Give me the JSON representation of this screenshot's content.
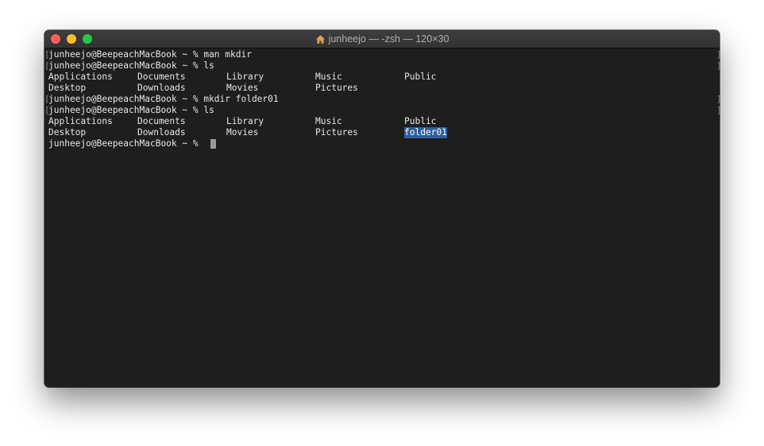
{
  "window": {
    "title": "junheejo — -zsh — 120×30",
    "traffic_lights": {
      "close_color": "#ff5f57",
      "minimize_color": "#febc2e",
      "zoom_color": "#28c840"
    },
    "title_icon": "home-icon"
  },
  "terminal": {
    "background": "#1e1e1e",
    "lines": [
      {
        "type": "prompt",
        "text": "junheejo@BeepeachMacBook ~ % man mkdir"
      },
      {
        "type": "prompt",
        "text": "junheejo@BeepeachMacBook ~ % ls"
      },
      {
        "type": "ls",
        "cols": [
          "Applications",
          "Documents",
          "Library",
          "Music",
          "Public"
        ]
      },
      {
        "type": "ls",
        "cols": [
          "Desktop",
          "Downloads",
          "Movies",
          "Pictures",
          ""
        ]
      },
      {
        "type": "prompt",
        "text": "junheejo@BeepeachMacBook ~ % mkdir folder01"
      },
      {
        "type": "prompt",
        "text": "junheejo@BeepeachMacBook ~ % ls"
      },
      {
        "type": "ls",
        "cols": [
          "Applications",
          "Documents",
          "Library",
          "Music",
          "Public"
        ]
      },
      {
        "type": "ls",
        "cols": [
          "Desktop",
          "Downloads",
          "Movies",
          "Pictures",
          "folder01"
        ],
        "highlight_col": 4
      },
      {
        "type": "current",
        "text": "junheejo@BeepeachMacBook ~ % "
      }
    ],
    "highlight_color": "#2f5f99"
  }
}
